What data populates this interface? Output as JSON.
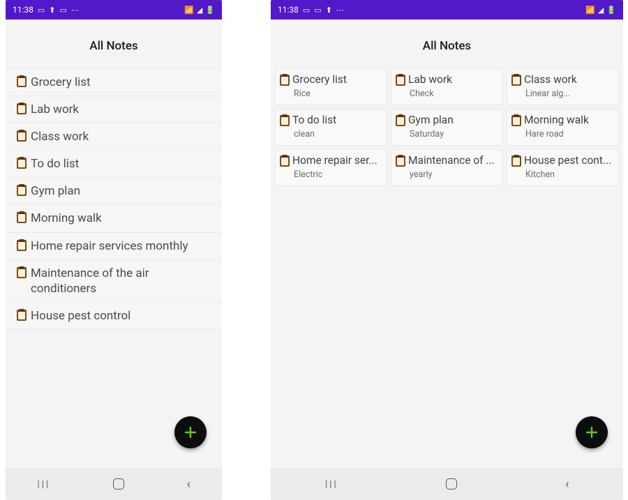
{
  "status": {
    "time": "11:38",
    "left_icons": [
      "▭",
      "⬆",
      "▭",
      "⋯"
    ],
    "right_icons": [
      "📶",
      "◢",
      "🔋"
    ]
  },
  "header": {
    "title": "All Notes"
  },
  "list_notes": [
    {
      "title": "Grocery list"
    },
    {
      "title": "Lab work"
    },
    {
      "title": "Class work"
    },
    {
      "title": "To do list"
    },
    {
      "title": "Gym plan"
    },
    {
      "title": "Morning walk"
    },
    {
      "title": "Home repair services monthly"
    },
    {
      "title": "Maintenance of the air conditioners"
    },
    {
      "title": "House pest control"
    }
  ],
  "grid_notes": [
    {
      "title": "Grocery list",
      "sub": "Rice"
    },
    {
      "title": "Lab work",
      "sub": "Check"
    },
    {
      "title": "Class work",
      "sub": "Linear alg..."
    },
    {
      "title": "To do list",
      "sub": "clean"
    },
    {
      "title": "Gym plan",
      "sub": "Saturday"
    },
    {
      "title": "Morning walk",
      "sub": "Hare road"
    },
    {
      "title": "Home repair ser...",
      "sub": "Electric"
    },
    {
      "title": "Maintenance of ...",
      "sub": "yearly"
    },
    {
      "title": "House pest cont...",
      "sub": "Kitchen"
    }
  ],
  "nav": {
    "recent": "III",
    "back": "‹"
  },
  "fab": {
    "label": "+"
  }
}
